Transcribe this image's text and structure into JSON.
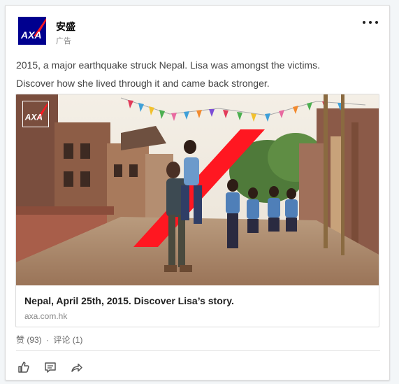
{
  "post": {
    "company_name": "安盛",
    "promoted_label": "广告",
    "more_icon": "more-dots-icon",
    "body_lines": [
      "2015, a major earthquake struck Nepal. Lisa was amongst the victims.",
      "Discover how she lived through it and came back stronger."
    ]
  },
  "ad": {
    "title": "Nepal, April 25th, 2015. Discover Lisa’s story.",
    "domain": "axa.com.hk",
    "logo_text": "AXA"
  },
  "social": {
    "likes": "赞 (93)",
    "separator": "·",
    "comments": "评论 (1)"
  },
  "actions": [
    {
      "name": "like",
      "icon": "thumbs-up-icon"
    },
    {
      "name": "comment",
      "icon": "comment-icon"
    },
    {
      "name": "share",
      "icon": "share-icon"
    }
  ],
  "colors": {
    "axa_blue": "#00008f",
    "axa_red": "#ff1721"
  }
}
